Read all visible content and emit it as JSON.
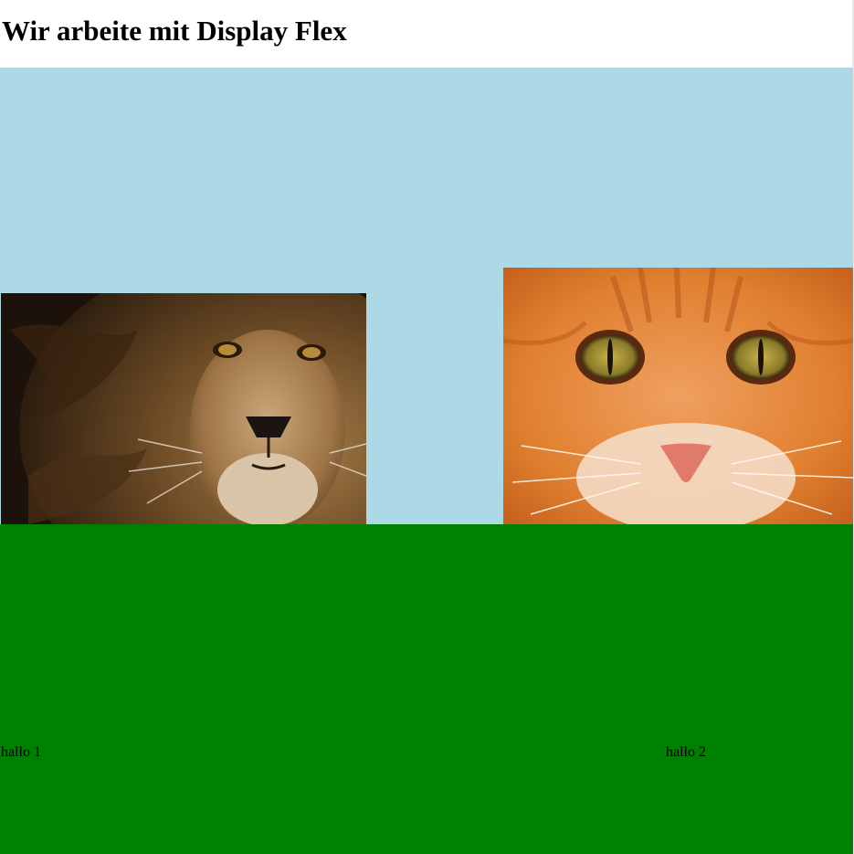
{
  "page": {
    "title": "Wir arbeite mit Display Flex"
  },
  "top_section": {
    "color": "#add8e6",
    "images": [
      {
        "subject": "lion",
        "icon": "lion-photo"
      },
      {
        "subject": "cat",
        "icon": "cat-photo"
      }
    ]
  },
  "bottom_section": {
    "color": "#008000",
    "items": [
      {
        "label": "hallo 1"
      },
      {
        "label": "hallo 2"
      }
    ]
  }
}
